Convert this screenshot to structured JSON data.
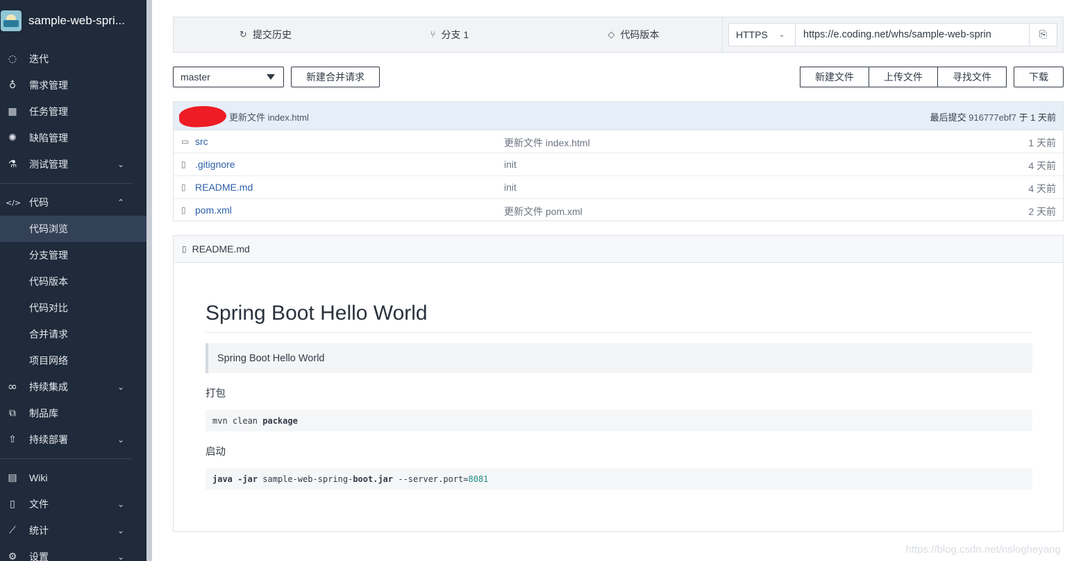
{
  "sidebar": {
    "project_name": "sample-web-spri...",
    "items": [
      {
        "label": "迭代",
        "icon": "iteration-icon",
        "glyph": "◌"
      },
      {
        "label": "需求管理",
        "icon": "bulb-icon",
        "glyph": "♁"
      },
      {
        "label": "任务管理",
        "icon": "task-icon",
        "glyph": "▦"
      },
      {
        "label": "缺陷管理",
        "icon": "bug-icon",
        "glyph": "✺"
      },
      {
        "label": "测试管理",
        "icon": "flask-icon",
        "glyph": "⚗"
      },
      {
        "label": "代码",
        "icon": "code-icon",
        "glyph": "</>"
      },
      {
        "label": "代码浏览"
      },
      {
        "label": "分支管理"
      },
      {
        "label": "代码版本"
      },
      {
        "label": "代码对比"
      },
      {
        "label": "合并请求"
      },
      {
        "label": "项目网络"
      },
      {
        "label": "持续集成",
        "icon": "infinity-icon",
        "glyph": "∞"
      },
      {
        "label": "制品库",
        "icon": "artifact-icon",
        "glyph": "⧉"
      },
      {
        "label": "持续部署",
        "icon": "rocket-icon",
        "glyph": "⇧"
      },
      {
        "label": "Wiki",
        "icon": "wiki-icon",
        "glyph": "▤"
      },
      {
        "label": "文件",
        "icon": "file-icon",
        "glyph": "▯"
      },
      {
        "label": "统计",
        "icon": "chart-icon",
        "glyph": "⟋"
      },
      {
        "label": "设置",
        "icon": "gear-icon",
        "glyph": "⚙"
      }
    ],
    "chevron_down": "⌄",
    "chevron_up": "⌃"
  },
  "topbar": {
    "tabs": [
      {
        "label": "提交历史",
        "icon": "history-icon",
        "glyph": "↻"
      },
      {
        "label": "分支 1",
        "icon": "branch-icon",
        "glyph": "⑂"
      },
      {
        "label": "代码版本",
        "icon": "tag-icon",
        "glyph": "◇"
      }
    ],
    "protocol": "HTTPS",
    "protocol_caret": "⌄",
    "clone_url": "https://e.coding.net/whs/sample-web-sprin",
    "copy_glyph": "⎘"
  },
  "toolbar": {
    "branch": "master",
    "new_merge_request": "新建合并请求",
    "new_file": "新建文件",
    "upload_file": "上传文件",
    "find_file": "寻找文件",
    "download": "下载"
  },
  "files": {
    "last_commit_message": "更新文件 index.html",
    "last_commit_label": "最后提交",
    "last_commit_hash": "916777ebf7",
    "last_commit_time": "于 1 天前",
    "rows": [
      {
        "name": "src",
        "message": "更新文件 index.html",
        "time": "1 天前",
        "type": "folder",
        "glyph": "▭"
      },
      {
        "name": ".gitignore",
        "message": "init",
        "time": "4 天前",
        "type": "file",
        "glyph": "▯"
      },
      {
        "name": "README.md",
        "message": "init",
        "time": "4 天前",
        "type": "file",
        "glyph": "▯"
      },
      {
        "name": "pom.xml",
        "message": "更新文件 pom.xml",
        "time": "2 天前",
        "type": "file",
        "glyph": "▯"
      }
    ]
  },
  "readme": {
    "filename": "README.md",
    "file_glyph": "▯",
    "title": "Spring Boot Hello World",
    "quote": "Spring Boot Hello World",
    "section_package": "打包",
    "code_package_plain": "mvn clean ",
    "code_package_bold": "package",
    "section_start": "启动",
    "code_start_java": "java",
    "code_start_flag": "-jar",
    "code_start_mid": " sample-web-spring-",
    "code_start_boot": "boot.jar",
    "code_start_rest": " --server.port=",
    "code_start_port": "8081"
  },
  "watermark": "https://blog.csdn.net/nslogheyang",
  "colors": {
    "sidebar_bg": "#1f2a3a",
    "sidebar_active": "#334156",
    "link": "#2b5fa8",
    "commit_bar": "#e6eef7",
    "redaction": "#ee1c24"
  }
}
